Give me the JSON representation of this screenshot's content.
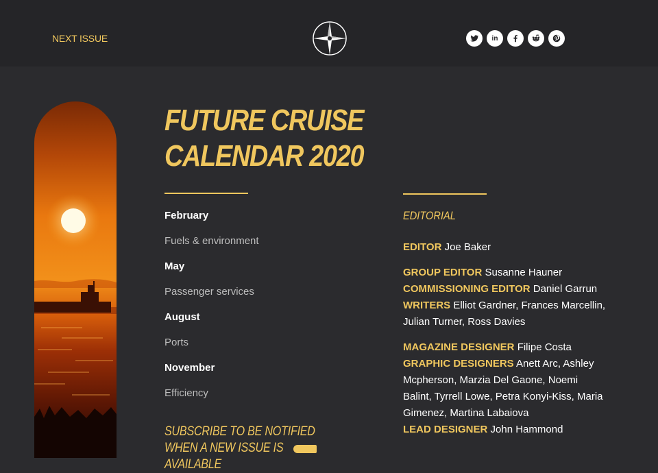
{
  "header": {
    "next_issue_label": "NEXT ISSUE",
    "logo_icon": "compass-star-icon",
    "social": [
      {
        "name": "twitter-icon",
        "label": "Twitter"
      },
      {
        "name": "linkedin-icon",
        "label": "in"
      },
      {
        "name": "facebook-icon",
        "label": "f"
      },
      {
        "name": "reddit-icon",
        "label": "Reddit"
      },
      {
        "name": "pinterest-icon",
        "label": "Pinterest"
      }
    ]
  },
  "main": {
    "title_line1": "FUTURE CRUISE",
    "title_line2": "CALENDAR 2020",
    "calendar": [
      {
        "month": "February",
        "topic": "Fuels & environment"
      },
      {
        "month": "May",
        "topic": "Passenger services"
      },
      {
        "month": "August",
        "topic": "Ports"
      },
      {
        "month": "November",
        "topic": "Efficiency"
      }
    ],
    "subscribe_text": "SUBSCRIBE TO BE NOTIFIED WHEN A NEW ISSUE IS AVAILABLE"
  },
  "editorial": {
    "heading": "EDITORIAL",
    "editor": {
      "role": "EDITOR",
      "names": "Joe Baker"
    },
    "group_editor": {
      "role": "GROUP EDITOR",
      "names": "Susanne Hauner"
    },
    "commissioning_editor": {
      "role": "COMMISSIONING EDITOR",
      "names": "Daniel Garrun"
    },
    "writers": {
      "role": "WRITERS",
      "names": "Elliot Gardner, Frances Marcellin, Julian Turner, Ross Davies"
    },
    "magazine_designer": {
      "role": "MAGAZINE DESIGNER",
      "names": "Filipe Costa"
    },
    "graphic_designers": {
      "role": "GRAPHIC DESIGNERS",
      "names": "Anett Arc, Ashley Mcpherson, Marzia Del Gaone, Noemi Balint, Tyrrell Lowe, Petra Konyi-Kiss,  Maria Gimenez, Martina Labaiova"
    },
    "lead_designer": {
      "role": "LEAD DESIGNER",
      "names": "John Hammond"
    }
  },
  "colors": {
    "accent": "#f0c75e",
    "background": "#2b2b2e",
    "header_background": "#252528"
  },
  "image": {
    "description_icon": "sunset-ship-image"
  }
}
